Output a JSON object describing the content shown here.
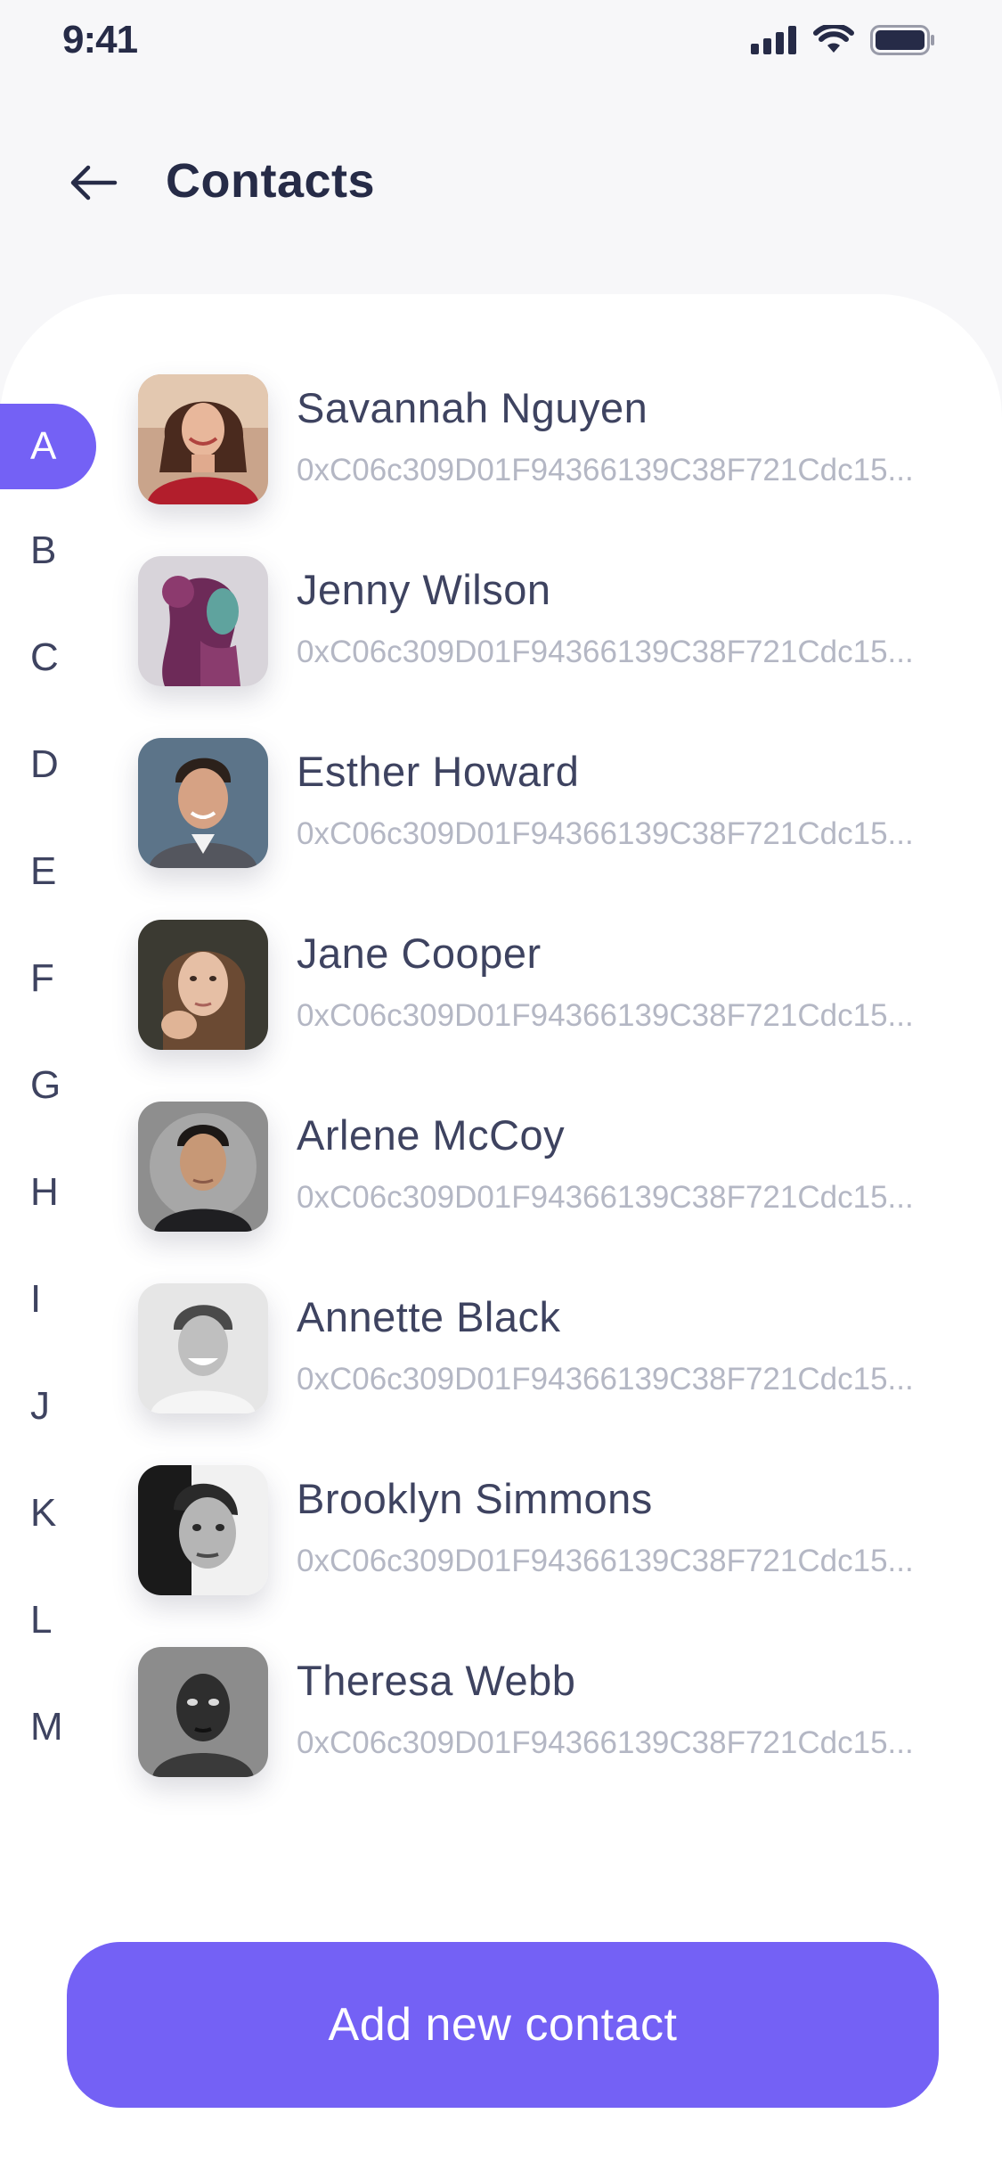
{
  "status_bar": {
    "time": "9:41",
    "icons": [
      "cellular-signal-icon",
      "wifi-icon",
      "battery-icon"
    ]
  },
  "header": {
    "title": "Contacts",
    "back_icon": "arrow-left-icon"
  },
  "alphabet_index": {
    "active": "A",
    "letters": [
      "A",
      "B",
      "C",
      "D",
      "E",
      "F",
      "G",
      "H",
      "I",
      "J",
      "K",
      "L",
      "M"
    ]
  },
  "contacts": [
    {
      "name": "Savannah Nguyen",
      "address": "0xC06c309D01F94366139C38F721Cdc15..."
    },
    {
      "name": "Jenny Wilson",
      "address": "0xC06c309D01F94366139C38F721Cdc15..."
    },
    {
      "name": "Esther Howard",
      "address": "0xC06c309D01F94366139C38F721Cdc15..."
    },
    {
      "name": "Jane Cooper",
      "address": "0xC06c309D01F94366139C38F721Cdc15..."
    },
    {
      "name": "Arlene McCoy",
      "address": "0xC06c309D01F94366139C38F721Cdc15..."
    },
    {
      "name": "Annette Black",
      "address": "0xC06c309D01F94366139C38F721Cdc15..."
    },
    {
      "name": "Brooklyn Simmons",
      "address": "0xC06c309D01F94366139C38F721Cdc15..."
    },
    {
      "name": "Theresa Webb",
      "address": "0xC06c309D01F94366139C38F721Cdc15..."
    }
  ],
  "actions": {
    "add_contact_label": "Add new contact"
  },
  "colors": {
    "accent": "#7461F5",
    "text_primary": "#262B47",
    "text_secondary": "#B4B7C4",
    "background": "#F7F7F9",
    "card": "#FFFFFF"
  }
}
